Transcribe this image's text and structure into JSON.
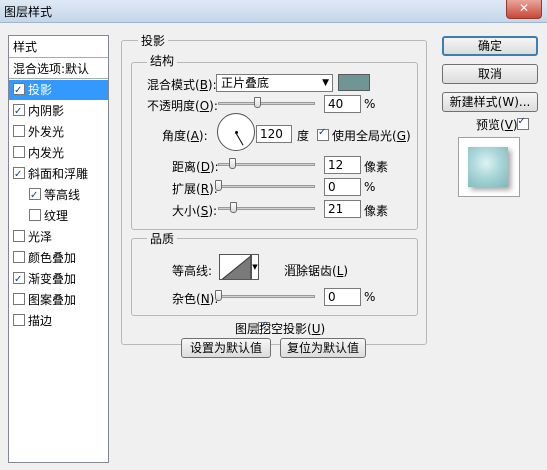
{
  "window": {
    "title": "图层样式",
    "close_glyph": "✕"
  },
  "style_list": {
    "header": "样式",
    "blending_options": "混合选项:默认",
    "items": [
      {
        "label": "投影",
        "checked": true,
        "selected": true,
        "indent": false
      },
      {
        "label": "内阴影",
        "checked": true,
        "selected": false,
        "indent": false
      },
      {
        "label": "外发光",
        "checked": false,
        "selected": false,
        "indent": false
      },
      {
        "label": "内发光",
        "checked": false,
        "selected": false,
        "indent": false
      },
      {
        "label": "斜面和浮雕",
        "checked": true,
        "selected": false,
        "indent": false
      },
      {
        "label": "等高线",
        "checked": true,
        "selected": false,
        "indent": true
      },
      {
        "label": "纹理",
        "checked": false,
        "selected": false,
        "indent": true
      },
      {
        "label": "光泽",
        "checked": false,
        "selected": false,
        "indent": false
      },
      {
        "label": "颜色叠加",
        "checked": false,
        "selected": false,
        "indent": false
      },
      {
        "label": "渐变叠加",
        "checked": true,
        "selected": false,
        "indent": false
      },
      {
        "label": "图案叠加",
        "checked": false,
        "selected": false,
        "indent": false
      },
      {
        "label": "描边",
        "checked": false,
        "selected": false,
        "indent": false
      }
    ]
  },
  "panel": {
    "title": "投影",
    "structure": {
      "title": "结构",
      "blend_mode_label": "混合模式(",
      "blend_mode_key": "B",
      "blend_mode_value": "正片叠底",
      "shadow_color": "#6f9595",
      "opacity_label": "不透明度(",
      "opacity_key": "O",
      "opacity_value": "40",
      "opacity_unit": "%",
      "opacity_fraction": 0.4,
      "angle_label": "角度(",
      "angle_key": "A",
      "angle_value": "120",
      "angle_unit": "度",
      "global_light_label": "使用全局光(",
      "global_light_key": "G",
      "global_light_checked": true,
      "distance_label": "距离(",
      "distance_key": "D",
      "distance_value": "12",
      "distance_unit": "像素",
      "spread_label": "扩展(",
      "spread_key": "R",
      "spread_value": "0",
      "spread_unit": "%",
      "size_label": "大小(",
      "size_key": "S",
      "size_value": "21",
      "size_unit": "像素"
    },
    "quality": {
      "title": "品质",
      "contour_label": "等高线:",
      "antialias_label": "消除锯齿(",
      "antialias_key": "L",
      "antialias_checked": false,
      "noise_label": "杂色(",
      "noise_key": "N",
      "noise_value": "0",
      "noise_unit": "%"
    },
    "knockout_label": "图层挖空投影(",
    "knockout_key": "U",
    "knockout_checked": true,
    "make_default": "设置为默认值",
    "reset_default": "复位为默认值"
  },
  "buttons": {
    "ok": "确定",
    "cancel": "取消",
    "new_style": "新建样式(W)...",
    "preview_label": "预览(",
    "preview_key": "V",
    "preview_checked": true
  }
}
